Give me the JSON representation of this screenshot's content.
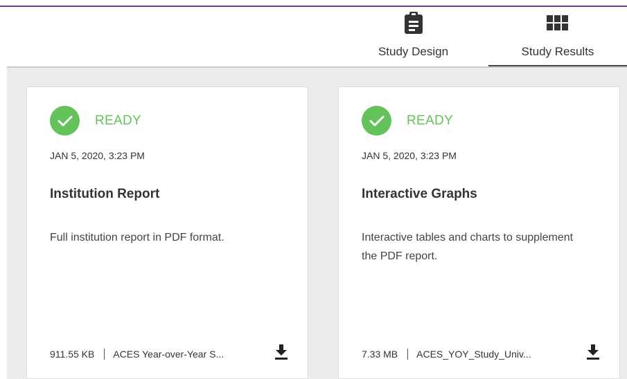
{
  "tabs": [
    {
      "label": "Study Design",
      "icon": "clipboard-icon",
      "active": false
    },
    {
      "label": "Study Results",
      "icon": "grid-icon",
      "active": true
    }
  ],
  "cards": [
    {
      "status": "READY",
      "timestamp": "JAN 5, 2020, 3:23 PM",
      "title": "Institution Report",
      "description": "Full institution report in PDF format.",
      "file_size": "911.55 KB",
      "file_name": "ACES Year-over-Year S..."
    },
    {
      "status": "READY",
      "timestamp": "JAN 5, 2020, 3:23 PM",
      "title": "Interactive Graphs",
      "description": "Interactive tables and charts to supplement the PDF report.",
      "file_size": "7.33 MB",
      "file_name": "ACES_YOY_Study_Univ..."
    }
  ],
  "colors": {
    "ready": "#63c25a",
    "accent_line": "#6a3d8f",
    "background": "#ececec"
  }
}
